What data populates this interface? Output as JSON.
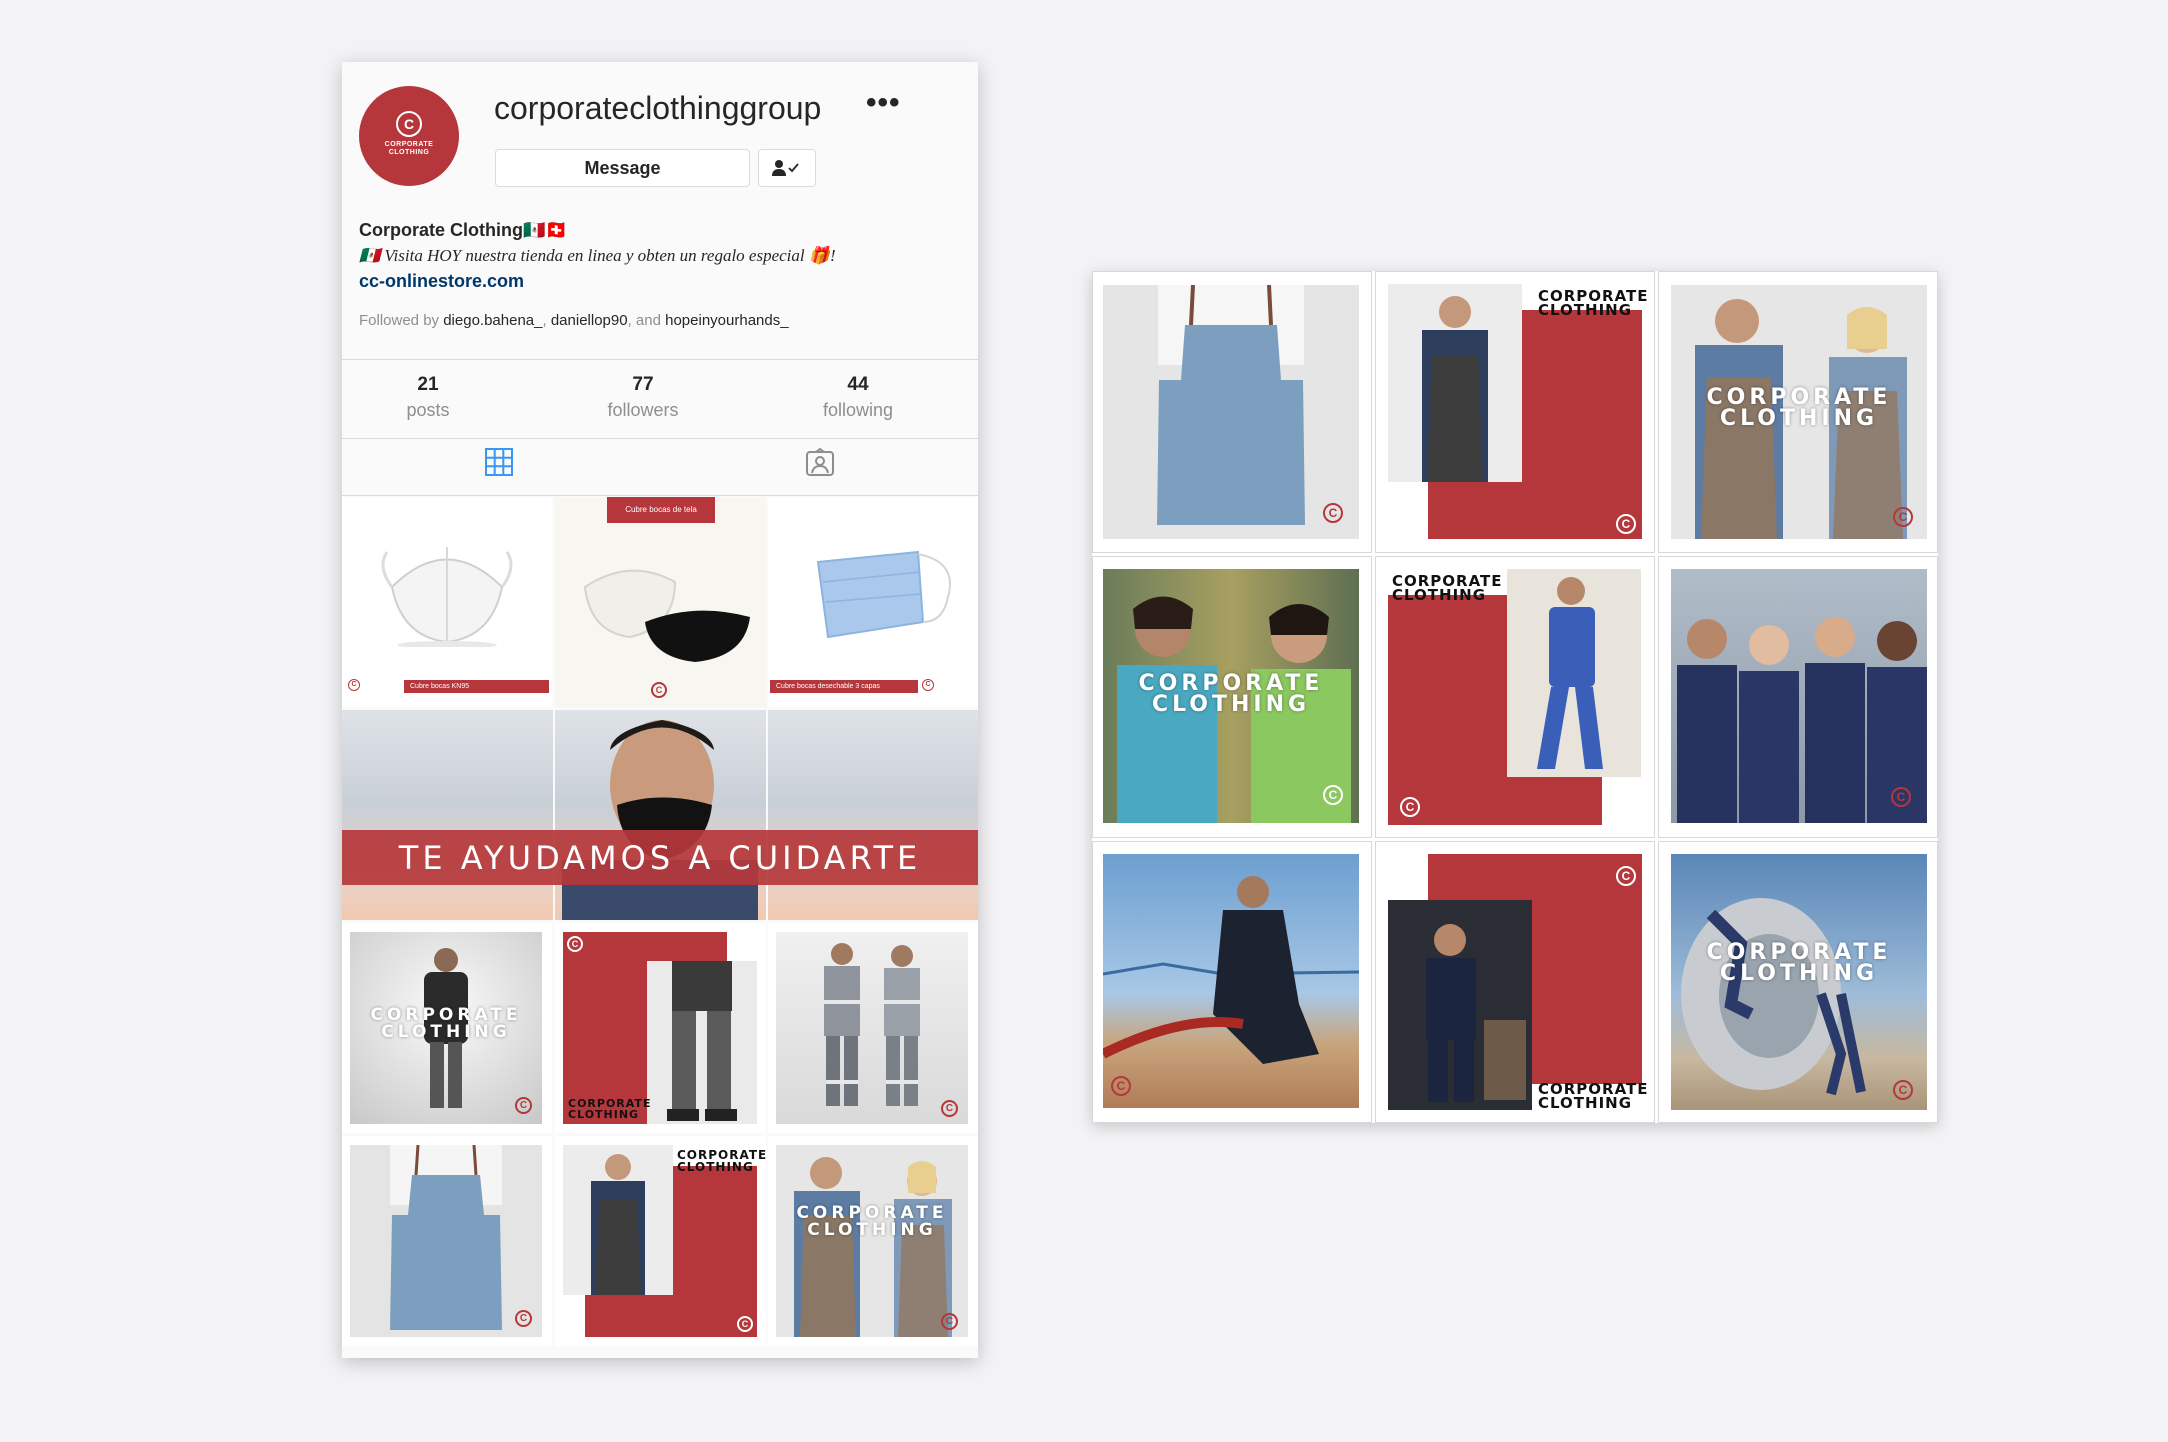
{
  "profile": {
    "username": "corporateclothinggroup",
    "more_icon": "•••",
    "avatar_mark": "C",
    "avatar_text_1": "CORPORATE",
    "avatar_text_2": "CLOTHING",
    "message_label": "Message",
    "full_name": "Corporate Clothing🇲🇽🇨🇭",
    "bio": "🇲🇽 Visita HOY nuestra tienda en linea y obten un regalo especial 🎁!",
    "link": "cc-onlinestore.com",
    "followed_prefix": "Followed by",
    "followed_users": [
      "diego.bahena_",
      "daniellop90",
      "hopeinyourhands_"
    ],
    "followed_sep": ", ",
    "followed_and": ", and"
  },
  "stats": [
    {
      "value": "21",
      "label": "posts"
    },
    {
      "value": "77",
      "label": "followers"
    },
    {
      "value": "44",
      "label": "following"
    }
  ],
  "tabs": {
    "grid_icon": "grid-icon",
    "tagged_icon": "tagged-icon"
  },
  "posts": {
    "mask_kn95_caption": "Cubre bocas KN95",
    "mask_fabric_caption": "Cubre bocas de tela",
    "mask_disposable_caption": "Cubre bocas desechable 3 capas",
    "banner_text": "TE AYUDAMOS A CUIDARTE",
    "brand_line1": "CORPORATE",
    "brand_line2": "CLOTHING",
    "logo_mark": "C"
  },
  "colors": {
    "brand_red": "#b5373b",
    "link_blue": "#00376b",
    "grid_icon_blue": "#3897f0"
  }
}
